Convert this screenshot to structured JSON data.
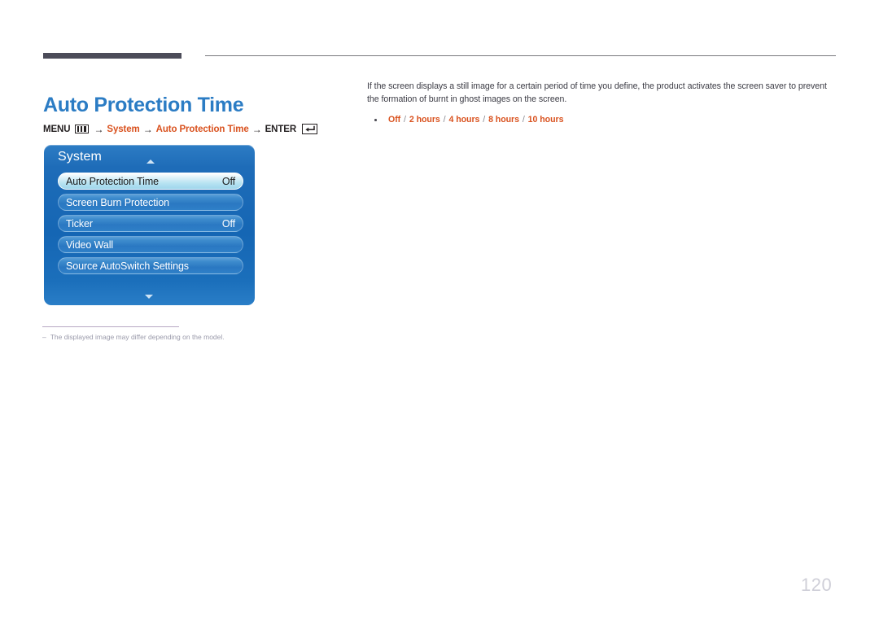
{
  "page": {
    "title": "Auto Protection Time",
    "number": "120"
  },
  "breadcrumb": {
    "menu_label": "MENU",
    "menu_icon": "menu-bars-icon",
    "arrow": "→",
    "step1": "System",
    "step2": "Auto Protection Time",
    "enter_label": "ENTER",
    "enter_icon": "enter-return-icon"
  },
  "osd": {
    "title": "System",
    "scroll_up_icon": "chevron-up-icon",
    "scroll_down_icon": "chevron-down-icon",
    "rows": [
      {
        "label": "Auto Protection Time",
        "value": "Off",
        "selected": true
      },
      {
        "label": "Screen Burn Protection",
        "value": "",
        "selected": false
      },
      {
        "label": "Ticker",
        "value": "Off",
        "selected": false
      },
      {
        "label": "Video Wall",
        "value": "",
        "selected": false
      },
      {
        "label": "Source AutoSwitch Settings",
        "value": "",
        "selected": false
      }
    ]
  },
  "footnote": {
    "dash": "–",
    "text": "The displayed image may differ depending on the model."
  },
  "description": {
    "paragraph": "If the screen displays a still image for a certain period of time you define, the product activates the screen saver to prevent the formation of burnt in ghost images on the screen.",
    "options": [
      "Off",
      "2 hours",
      "4 hours",
      "8 hours",
      "10 hours"
    ],
    "option_separator": "/"
  },
  "colors": {
    "title_blue": "#2b7cc4",
    "accent_orange": "#d9521f",
    "rule_dark": "#4c4c59",
    "panel_blue": "#1566b4",
    "page_number_gray": "#cfcfd8"
  }
}
